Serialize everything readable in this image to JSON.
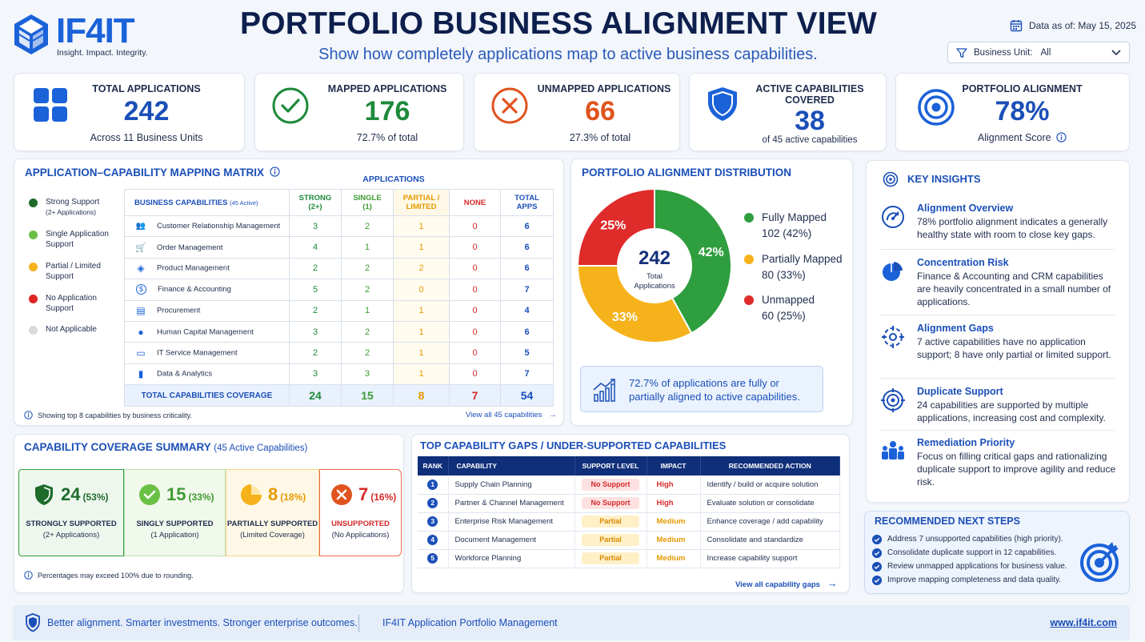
{
  "header": {
    "logo_text": "IF4IT",
    "logo_tagline": "Insight. Impact. Integrity.",
    "title": "PORTFOLIO BUSINESS ALIGNMENT VIEW",
    "subtitle": "Show how completely applications map to active business capabilities.",
    "data_as_of": "Data as of: May 15, 2025",
    "filter_label": "Business Unit:",
    "filter_value": "All"
  },
  "kpis": [
    {
      "label": "TOTAL APPLICATIONS",
      "value": "242",
      "sub": "Across 11 Business Units",
      "icon": "grid-icon",
      "color": "#1b4fb8"
    },
    {
      "label": "MAPPED APPLICATIONS",
      "value": "176",
      "sub": "72.7% of total",
      "icon": "check-circle-icon",
      "color": "#1e8a3b"
    },
    {
      "label": "UNMAPPED APPLICATIONS",
      "value": "66",
      "sub": "27.3% of total",
      "icon": "x-circle-icon",
      "color": "#e0541f"
    },
    {
      "label": "ACTIVE CAPABILITIES",
      "label2": "COVERED",
      "value": "38",
      "sub": "of 45 active capabilities",
      "icon": "shield-icon",
      "color": "#1b4fb8"
    },
    {
      "label": "PORTFOLIO ALIGNMENT",
      "value": "78%",
      "sub": "Alignment Score",
      "icon": "target-icon",
      "color": "#1b4fb8"
    }
  ],
  "matrix": {
    "title": "APPLICATION–CAPABILITY MAPPING MATRIX",
    "applications_header": "APPLICATIONS",
    "capabilities_header": "BUSINESS CAPABILITIES",
    "capabilities_sub": "(45 Active)",
    "legend": [
      {
        "label": "Strong Support",
        "sub": "(2+ Applications)",
        "color": "#1e6b2c"
      },
      {
        "label": "Single Application Support",
        "sub": "",
        "color": "#6ac045"
      },
      {
        "label": "Partial / Limited Support",
        "sub": "",
        "color": "#f5b21b"
      },
      {
        "label": "No Application Support",
        "sub": "",
        "color": "#e02424"
      },
      {
        "label": "Not Applicable",
        "sub": "",
        "color": "#d9d9d9"
      }
    ],
    "columns": [
      {
        "label": "STRONG",
        "label2": "(2+)",
        "color": "#1e8a3b"
      },
      {
        "label": "SINGLE",
        "label2": "(1)",
        "color": "#3f9b32"
      },
      {
        "label": "PARTIAL /",
        "label2": "LIMITED",
        "color": "#e69a00"
      },
      {
        "label": "NONE",
        "label2": "",
        "color": "#d62a2a"
      },
      {
        "label": "TOTAL",
        "label2": "APPS",
        "color": "#1b4fb8"
      }
    ],
    "rows": [
      {
        "name": "Customer Relationship Management",
        "icon": "people-icon",
        "vals": [
          "3",
          "2",
          "1",
          "0",
          "6"
        ]
      },
      {
        "name": "Order Management",
        "icon": "cart-icon",
        "vals": [
          "4",
          "1",
          "1",
          "0",
          "6"
        ]
      },
      {
        "name": "Product Management",
        "icon": "box-icon",
        "vals": [
          "2",
          "2",
          "2",
          "0",
          "6"
        ]
      },
      {
        "name": "Finance & Accounting",
        "icon": "dollar-icon",
        "vals": [
          "5",
          "2",
          "0",
          "0",
          "7"
        ]
      },
      {
        "name": "Procurement",
        "icon": "clipboard-icon",
        "vals": [
          "2",
          "1",
          "1",
          "0",
          "4"
        ]
      },
      {
        "name": "Human Capital Management",
        "icon": "person-icon",
        "vals": [
          "3",
          "2",
          "1",
          "0",
          "6"
        ]
      },
      {
        "name": "IT Service Management",
        "icon": "monitor-icon",
        "vals": [
          "2",
          "2",
          "1",
          "0",
          "5"
        ]
      },
      {
        "name": "Data & Analytics",
        "icon": "bar-chart-icon",
        "vals": [
          "3",
          "3",
          "1",
          "0",
          "7"
        ]
      }
    ],
    "total_label": "TOTAL CAPABILITIES COVERAGE",
    "totals": [
      "24",
      "15",
      "8",
      "7",
      "54"
    ],
    "note": "Showing top 8 capabilities by business criticality.",
    "view_all": "View all 45 capabilities"
  },
  "distribution": {
    "title": "PORTFOLIO ALIGNMENT DISTRIBUTION",
    "center_value": "242",
    "center_label1": "Total",
    "center_label2": "Applications",
    "slices": [
      {
        "label": "Fully Mapped",
        "detail": "102 (42%)",
        "pct": 42,
        "pct_label": "42%",
        "color": "#2e9e3e"
      },
      {
        "label": "Partially Mapped",
        "detail": "80 (33%)",
        "pct": 33,
        "pct_label": "33%",
        "color": "#f5b21b"
      },
      {
        "label": "Unmapped",
        "detail": "60 (25%)",
        "pct": 25,
        "pct_label": "25%",
        "color": "#e02b2b"
      }
    ],
    "callout": "72.7% of applications are fully or partially aligned to active capabilities."
  },
  "insights": {
    "title": "KEY INSIGHTS",
    "items": [
      {
        "heading": "Alignment Overview",
        "body": "78% portfolio alignment indicates a generally healthy state with room to close key gaps.",
        "icon": "gauge-icon"
      },
      {
        "heading": "Concentration Risk",
        "body": "Finance & Accounting and CRM capabilities are heavily concentrated in a small number of applications.",
        "icon": "pie-icon"
      },
      {
        "heading": "Alignment Gaps",
        "body": "7 active capabilities have no application support; 8 have only partial or limited support.",
        "icon": "crosshair-icon"
      },
      {
        "heading": "Duplicate Support",
        "body": "24 capabilities are supported by multiple applications, increasing cost and complexity.",
        "icon": "target-icon"
      },
      {
        "heading": "Remediation Priority",
        "body": "Focus on filling critical gaps and rationalizing duplicate support to improve agility and reduce risk.",
        "icon": "team-icon"
      }
    ]
  },
  "coverage": {
    "title": "CAPABILITY COVERAGE SUMMARY",
    "title_sub": "(45 Active Capabilities)",
    "items": [
      {
        "value": "24",
        "pct": "(53%)",
        "label": "STRONGLY SUPPORTED",
        "sub": "(2+ Applications)",
        "color": "#1e6b2c",
        "bg": "#eef7ee",
        "border": "#2e9e3e",
        "icon": "shield-check-icon"
      },
      {
        "value": "15",
        "pct": "(33%)",
        "label": "SINGLY SUPPORTED",
        "sub": "(1 Application)",
        "color": "#3f9b32",
        "bg": "#f1f8ec",
        "border": "#bfe0b3",
        "icon": "check-circle-icon"
      },
      {
        "value": "8",
        "pct": "(18%)",
        "label": "PARTIALLY SUPPORTED",
        "sub": "(Limited Coverage)",
        "color": "#e69a00",
        "bg": "#fff8e6",
        "border": "#f5d58a",
        "icon": "partial-pie-icon"
      },
      {
        "value": "7",
        "pct": "(16%)",
        "label": "UNSUPPORTED",
        "sub": "(No Applications)",
        "color": "#d62a2a",
        "bg": "#fff",
        "border": "#e86a4a",
        "icon": "x-circle-icon"
      }
    ],
    "note": "Percentages may exceed 100% due to rounding."
  },
  "gaps": {
    "title": "TOP CAPABILITY GAPS / UNDER-SUPPORTED CAPABILITIES",
    "headers": [
      "RANK",
      "CAPABILITY",
      "SUPPORT LEVEL",
      "IMPACT",
      "RECOMMENDED ACTION"
    ],
    "rows": [
      {
        "rank": "1",
        "capability": "Supply Chain Planning",
        "support": "No Support",
        "support_tone": "red",
        "impact": "High",
        "impact_color": "#d62a2a",
        "action": "Identify / build or acquire solution"
      },
      {
        "rank": "2",
        "capability": "Partner & Channel Management",
        "support": "No Support",
        "support_tone": "red",
        "impact": "High",
        "impact_color": "#d62a2a",
        "action": "Evaluate solution or consolidate"
      },
      {
        "rank": "3",
        "capability": "Enterprise Risk Management",
        "support": "Partial",
        "support_tone": "amber",
        "impact": "Medium",
        "impact_color": "#e69a00",
        "action": "Enhance coverage / add capability"
      },
      {
        "rank": "4",
        "capability": "Document Management",
        "support": "Partial",
        "support_tone": "amber",
        "impact": "Medium",
        "impact_color": "#e69a00",
        "action": "Consolidate and standardize"
      },
      {
        "rank": "5",
        "capability": "Workforce Planning",
        "support": "Partial",
        "support_tone": "amber",
        "impact": "Medium",
        "impact_color": "#e69a00",
        "action": "Increase capability support"
      }
    ],
    "view_all": "View all capability gaps"
  },
  "next_steps": {
    "title": "RECOMMENDED NEXT STEPS",
    "items": [
      "Address 7 unsupported capabilities (high priority).",
      "Consolidate duplicate support in 12 capabilities.",
      "Review unmapped applications for business value.",
      "Improve mapping completeness and data quality."
    ]
  },
  "footer": {
    "tagline": "Better alignment. Smarter investments. Stronger enterprise outcomes.",
    "product": "IF4IT Application Portfolio Management",
    "url": "www.if4it.com"
  }
}
